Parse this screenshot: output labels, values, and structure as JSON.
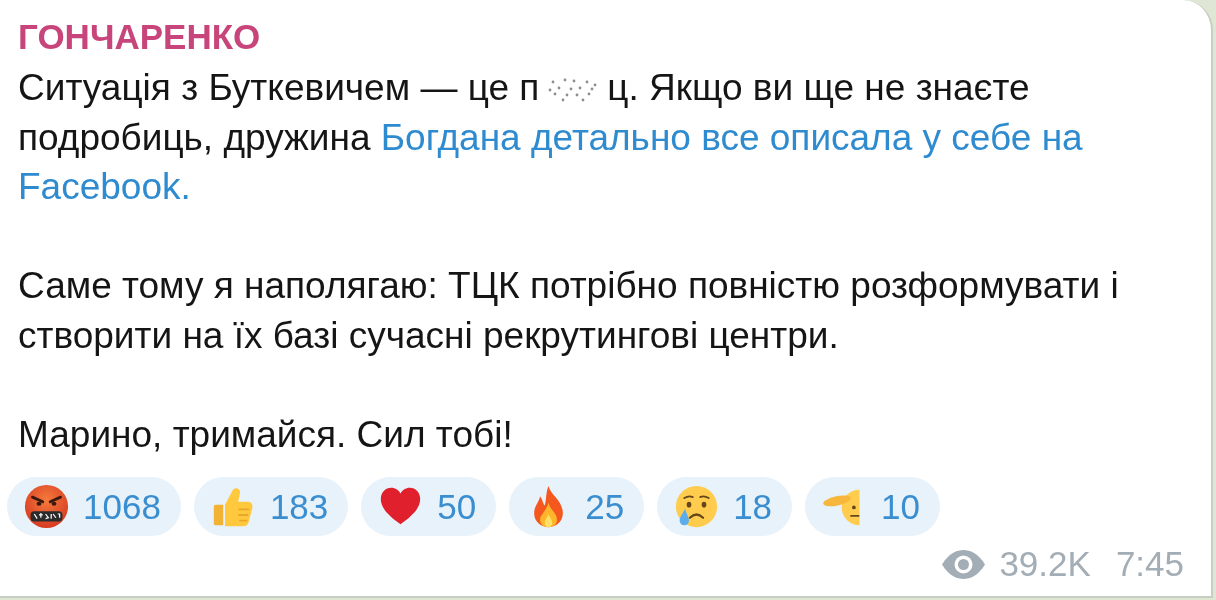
{
  "message": {
    "author": "ГОНЧАРЕНКО",
    "paragraphs": [
      {
        "segments": [
          {
            "kind": "text",
            "text": "Ситуація з Буткевичем — це п"
          },
          {
            "kind": "spoiler"
          },
          {
            "kind": "text",
            "text": "ц. Якщо ви ще не знаєте подробиць, дружина "
          },
          {
            "kind": "link",
            "text": "Богдана детально все описала у себе на"
          },
          {
            "kind": "link",
            "text": "Facebook."
          }
        ]
      },
      {
        "segments": [
          {
            "kind": "text",
            "text": "Саме тому я наполягаю: ТЦК потрібно повністю розформувати і створити на їх базі сучасні рекрутингові центри."
          }
        ]
      },
      {
        "segments": [
          {
            "kind": "text",
            "text": "Марино, тримайся. Сил тобі!"
          }
        ]
      }
    ],
    "reactions": [
      {
        "kind": "cursing",
        "count": "1068",
        "selected": false
      },
      {
        "kind": "thumbs_up",
        "count": "183",
        "selected": false
      },
      {
        "kind": "heart",
        "count": "50",
        "selected": false
      },
      {
        "kind": "fire",
        "count": "25",
        "selected": false
      },
      {
        "kind": "crying",
        "count": "18",
        "selected": false
      },
      {
        "kind": "salute",
        "count": "10",
        "selected": false
      }
    ],
    "views": "39.2K",
    "time": "7:45"
  }
}
